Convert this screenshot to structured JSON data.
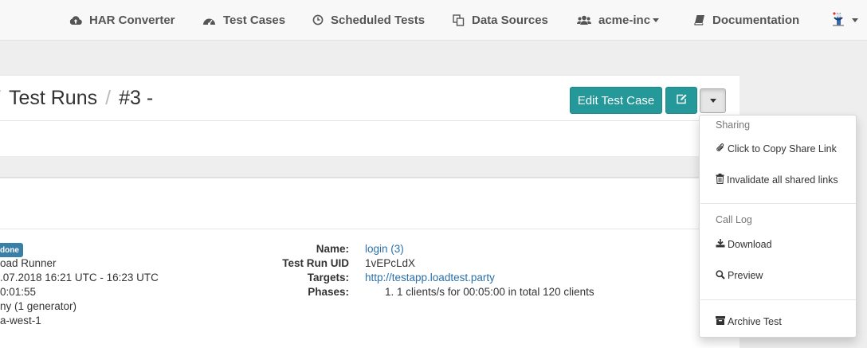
{
  "nav": {
    "har_converter": "HAR Converter",
    "test_cases": "Test Cases",
    "scheduled_tests": "Scheduled Tests",
    "data_sources": "Data Sources",
    "org": "acme-inc",
    "documentation": "Documentation"
  },
  "header": {
    "breadcrumb_section": "Test Runs",
    "run_number": "#3 -",
    "edit_button": "Edit Test Case"
  },
  "run": {
    "status_badge": "done",
    "runner": "oad Runner",
    "time_range": ".07.2018 16:21 UTC - 16:23 UTC",
    "duration": "0:01:55",
    "generators": "ny (1 generator)",
    "region": "a-west-1",
    "labels": {
      "name": "Name:",
      "uid": "Test Run UID",
      "targets": "Targets:",
      "phases": "Phases:"
    },
    "name_link": "login",
    "name_count": "(3)",
    "uid": "1vEPcLdX",
    "target": "http://testapp.loadtest.party",
    "phase": "1. 1 clients/s for 00:05:00 in total 120 clients"
  },
  "dropdown": {
    "sharing_header": "Sharing",
    "copy_share_link": "Click to Copy Share Link",
    "invalidate_links": "Invalidate all shared links",
    "call_log_header": "Call Log",
    "download": "Download",
    "preview": "Preview",
    "archive": "Archive Test"
  },
  "colors": {
    "accent": "#25999a",
    "link": "#2a6fa8",
    "badge": "#3a7fa7"
  },
  "icons": [
    "cloud-upload-icon",
    "dashboard-icon",
    "clock-icon",
    "copy-icon",
    "users-icon",
    "book-icon",
    "avatar",
    "pencil-square-icon",
    "caret-down-icon",
    "paperclip-icon",
    "trash-icon",
    "download-icon",
    "search-icon",
    "archive-icon"
  ]
}
